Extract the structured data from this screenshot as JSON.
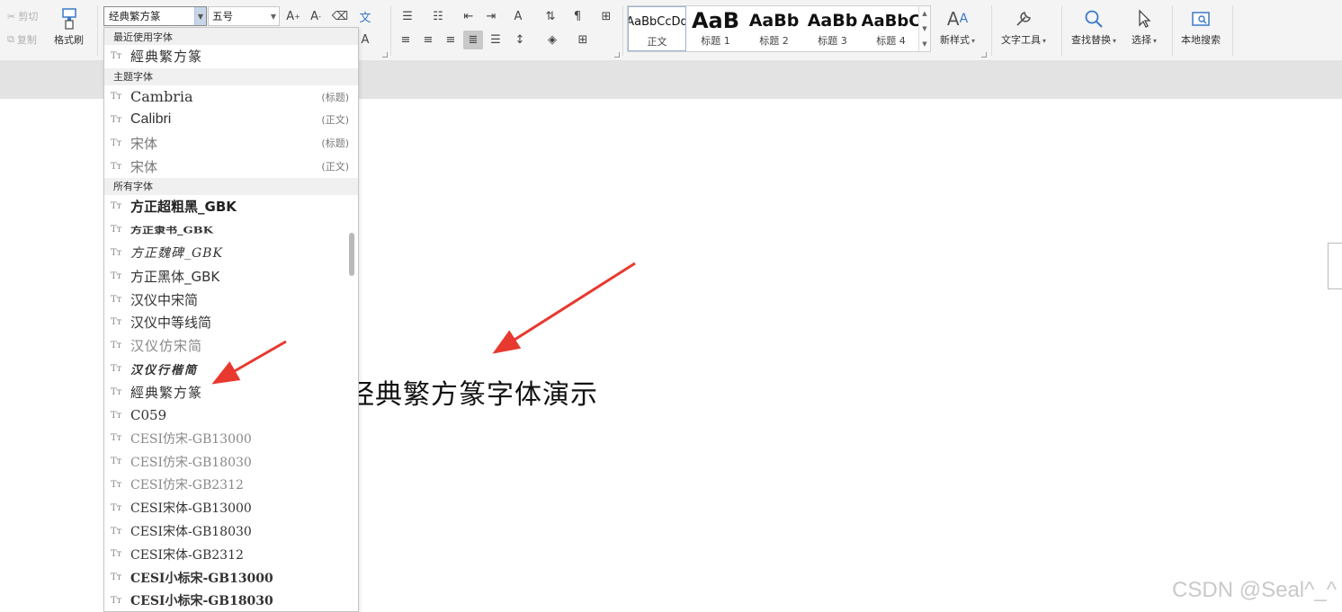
{
  "clipboard": {
    "cut": "剪切",
    "copy": "复制",
    "format_painter": "格式刷"
  },
  "font": {
    "current_font": "经典繁方篆",
    "current_size": "五号"
  },
  "styles": {
    "items": [
      {
        "preview": "AaBbCcDd",
        "name": "正文"
      },
      {
        "preview": "AaB",
        "name": "标题 1"
      },
      {
        "preview": "AaBb",
        "name": "标题 2"
      },
      {
        "preview": "AaBb",
        "name": "标题 3"
      },
      {
        "preview": "AaBbC",
        "name": "标题 4"
      }
    ],
    "new_style": "新样式"
  },
  "tools": {
    "text_tools": "文字工具",
    "find_replace": "查找替换",
    "select": "选择",
    "local_search": "本地搜索"
  },
  "font_dropdown": {
    "sections": [
      {
        "header": "最近使用字体",
        "items": [
          {
            "name": "經典繁方篆"
          }
        ]
      },
      {
        "header": "主题字体",
        "items": [
          {
            "name": "Cambria",
            "tag": "(标题)"
          },
          {
            "name": "Calibri",
            "tag": "(正文)"
          },
          {
            "name": "宋体",
            "tag": "(标题)"
          },
          {
            "name": "宋体",
            "tag": "(正文)"
          }
        ]
      },
      {
        "header": "所有字体",
        "items": [
          {
            "name": "方正超粗黑_GBK"
          },
          {
            "name": "方正隶书_GBK"
          },
          {
            "name": "方正魏碑_GBK"
          },
          {
            "name": "方正黑体_GBK"
          },
          {
            "name": "汉仪中宋简"
          },
          {
            "name": "汉仪中等线简"
          },
          {
            "name": "汉仪仿宋简"
          },
          {
            "name": "汉仪行楷简"
          },
          {
            "name": "經典繁方篆"
          },
          {
            "name": "C059"
          },
          {
            "name": "CESI仿宋-GB13000"
          },
          {
            "name": "CESI仿宋-GB18030"
          },
          {
            "name": "CESI仿宋-GB2312"
          },
          {
            "name": "CESI宋体-GB13000"
          },
          {
            "name": "CESI宋体-GB18030"
          },
          {
            "name": "CESI宋体-GB2312"
          },
          {
            "name": "CESI小标宋-GB13000"
          },
          {
            "name": "CESI小标宋-GB18030"
          }
        ]
      }
    ]
  },
  "document": {
    "body_text": "经典繁方篆字体演示"
  },
  "watermark": "CSDN @Seal^_^"
}
